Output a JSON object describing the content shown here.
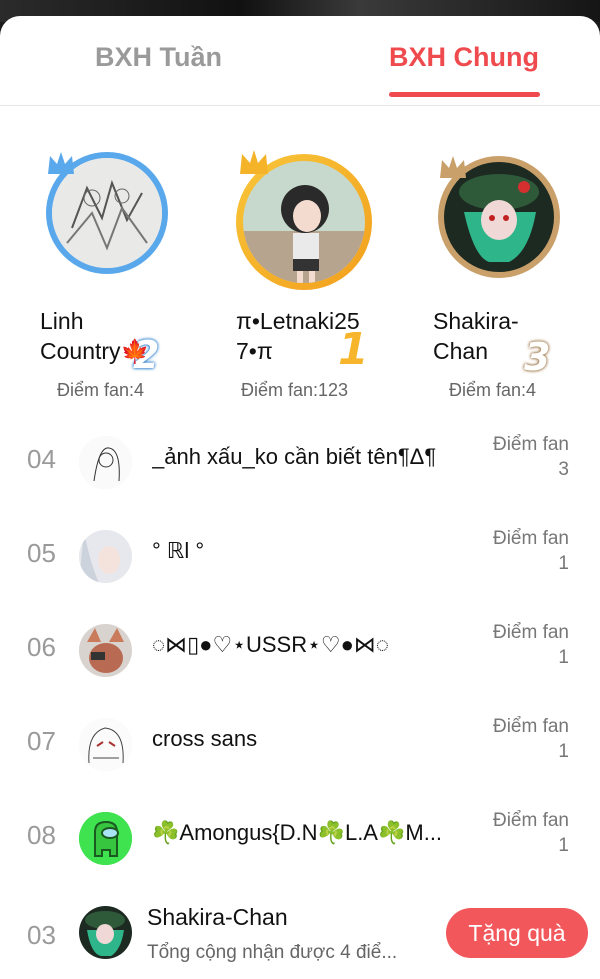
{
  "tabs": [
    {
      "label": "BXH Tuần",
      "active": false
    },
    {
      "label": "BXH Chung",
      "active": true
    }
  ],
  "podium": [
    {
      "rank": "2",
      "name_line1": "Linh",
      "name_line2": "Country🍁",
      "score": "Điểm fan:4",
      "ring_color": "#5aa8ec"
    },
    {
      "rank": "1",
      "name_line1": "π•Letnaki25",
      "name_line2": "7•π",
      "score": "Điểm fan:123",
      "ring_color": "#f5b32a"
    },
    {
      "rank": "3",
      "name_line1": "Shakira-",
      "name_line2": "Chan",
      "score": "Điểm fan:4",
      "ring_color": "#c9a06a"
    }
  ],
  "list": [
    {
      "rank": "04",
      "name": "_ảnh xấu_ko cần biết tên¶Δ¶",
      "fan_label": "Điểm fan",
      "fan_value": "3"
    },
    {
      "rank": "05",
      "name": "° ℝl °",
      "fan_label": "Điểm fan",
      "fan_value": "1"
    },
    {
      "rank": "06",
      "name": "◌⋈▯●♡⋆USSR⋆♡●⋈◌",
      "fan_label": "Điểm fan",
      "fan_value": "1"
    },
    {
      "rank": "07",
      "name": "cross sans",
      "fan_label": "Điểm fan",
      "fan_value": "1"
    },
    {
      "rank": "08",
      "name": "☘️Amongus{D.N☘️L.A☘️M...",
      "fan_label": "Điểm fan",
      "fan_value": "1"
    }
  ],
  "me": {
    "rank": "03",
    "name": "Shakira-Chan",
    "subtitle": "Tổng cộng nhận được 4 điể...",
    "gift_label": "Tặng quà"
  },
  "colors": {
    "accent": "#ef4b4f",
    "gift_button": "#f2575c",
    "gold": "#f5b32a",
    "silver_blue": "#5aa8ec",
    "bronze": "#c9a06a"
  }
}
